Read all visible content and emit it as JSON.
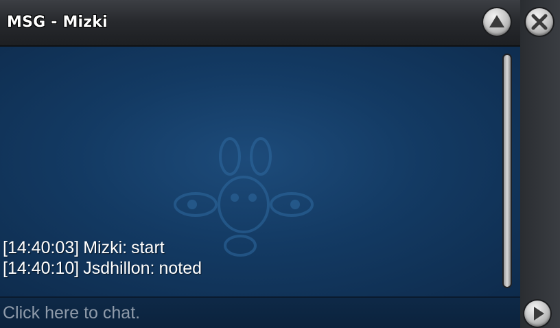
{
  "window": {
    "title": "MSG - Mizki"
  },
  "controls": {
    "minimize_icon": "triangle-up-icon",
    "close_icon": "close-icon",
    "send_icon": "arrow-right-icon"
  },
  "messages": [
    {
      "timestamp": "[14:40:03]",
      "sender": "Mizki:",
      "text": "start"
    },
    {
      "timestamp": "[14:40:10]",
      "sender": "Jsdhillon:",
      "text": "noted"
    }
  ],
  "input": {
    "placeholder": "Click here to chat.",
    "value": ""
  },
  "colors": {
    "chat_background": "#133a63",
    "titlebar": "#27292d",
    "message_text": "#ffffff",
    "placeholder_text": "#8f9baa"
  }
}
